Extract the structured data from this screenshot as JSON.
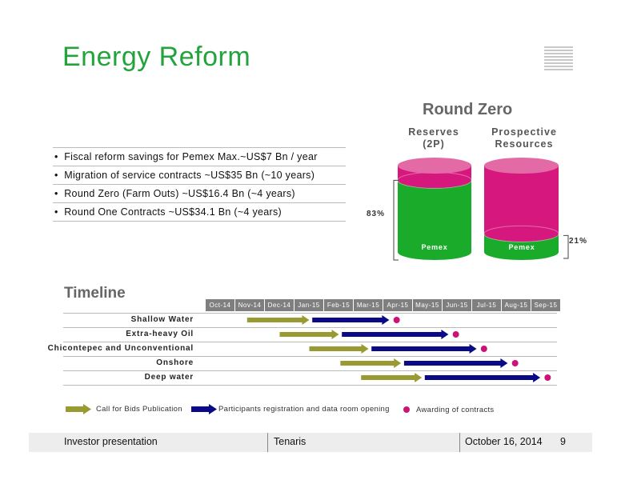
{
  "title": "Energy Reform",
  "round_zero": {
    "title": "Round Zero",
    "reserves_label_1": "Reserves",
    "reserves_label_2": "(2P)",
    "prospective_label_1": "Prospective",
    "prospective_label_2": "Resources",
    "reserves_pemex_pct_label": "83%",
    "reserves_pemex_share": 0.83,
    "prospective_pemex_pct_label": "21%",
    "prospective_pemex_share": 0.21,
    "cylinder_label": "Pemex",
    "colors": {
      "pemex": "#1bab2b",
      "other": "#d6187e",
      "top": "#e46aa6"
    }
  },
  "bullets": [
    "Fiscal reform savings for Pemex Max.~US$7 Bn / year",
    "Migration of service contracts ~US$35 Bn (~10 years)",
    "Round Zero (Farm Outs) ~US$16.4 Bn (~4 years)",
    "Round One Contracts ~US$34.1 Bn (~4 years)"
  ],
  "timeline": {
    "label": "Timeline",
    "months": [
      "Oct-14",
      "Nov-14",
      "Dec-14",
      "Jan-15",
      "Feb-15",
      "Mar-15",
      "Apr-15",
      "May-15",
      "Jun-15",
      "Jul-15",
      "Aug-15",
      "Sep-15"
    ],
    "rows": [
      {
        "name": "Shallow Water",
        "call_start": 1.4,
        "call_end": 3.5,
        "reg_start": 3.6,
        "reg_end": 6.2,
        "award": 6.45
      },
      {
        "name": "Extra-heavy Oil",
        "call_start": 2.5,
        "call_end": 4.5,
        "reg_start": 4.6,
        "reg_end": 8.2,
        "award": 8.45
      },
      {
        "name": "Chicontepec and Unconventional",
        "call_start": 3.5,
        "call_end": 5.5,
        "reg_start": 5.6,
        "reg_end": 9.15,
        "award": 9.4
      },
      {
        "name": "Onshore",
        "call_start": 4.55,
        "call_end": 6.6,
        "reg_start": 6.7,
        "reg_end": 10.2,
        "award": 10.45
      },
      {
        "name": "Deep water",
        "call_start": 5.25,
        "call_end": 7.3,
        "reg_start": 7.4,
        "reg_end": 11.3,
        "award": 11.55
      }
    ],
    "colors": {
      "call": "#9a9a32",
      "reg": "#0a0a88",
      "award": "#cc1177"
    },
    "legend": {
      "call": "Call for Bids Publication",
      "reg": "Participants registration and data room opening",
      "award": "Awarding of contracts"
    }
  },
  "footer": {
    "left": "Investor presentation",
    "center": "Tenaris",
    "date": "October 16, 2014",
    "page": "9"
  }
}
